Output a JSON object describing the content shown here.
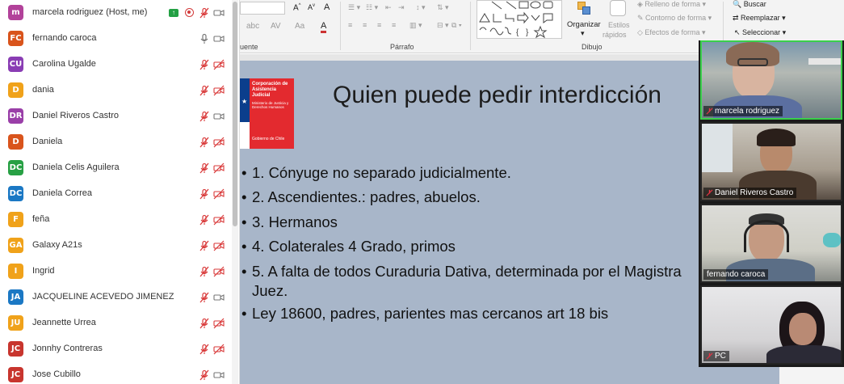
{
  "participants": [
    {
      "initials": "m",
      "name": "marcela rodriguez (Host, me)",
      "color": "#b2429a",
      "mic": "host"
    },
    {
      "initials": "FC",
      "name": "fernando caroca",
      "color": "#d9541c",
      "mic": "on"
    },
    {
      "initials": "CU",
      "name": "Carolina Ugalde",
      "color": "#8a3db4",
      "mic": "muted-video-off"
    },
    {
      "initials": "D",
      "name": "dania",
      "color": "#f0a21a",
      "mic": "muted-video-off"
    },
    {
      "initials": "DR",
      "name": "Daniel Riveros Castro",
      "color": "#9a3fa8",
      "mic": "muted-video-on"
    },
    {
      "initials": "D",
      "name": "Daniela",
      "color": "#d9541c",
      "mic": "muted-video-off"
    },
    {
      "initials": "DC",
      "name": "Daniela Celis Aguilera",
      "color": "#27a044",
      "mic": "muted-video-off"
    },
    {
      "initials": "DC",
      "name": "Daniela Correa",
      "color": "#1b78c4",
      "mic": "muted-video-off"
    },
    {
      "initials": "F",
      "name": "feña",
      "color": "#f0a21a",
      "mic": "muted-video-off"
    },
    {
      "initials": "GA",
      "name": "Galaxy A21s",
      "color": "#f0a21a",
      "mic": "muted-video-off"
    },
    {
      "initials": "I",
      "name": "Ingrid",
      "color": "#f0a21a",
      "mic": "muted-video-off"
    },
    {
      "initials": "JA",
      "name": "JACQUELINE ACEVEDO JIMENEZ",
      "color": "#1b78c4",
      "mic": "muted-video-on"
    },
    {
      "initials": "JU",
      "name": "Jeannette Urrea",
      "color": "#f0a21a",
      "mic": "muted-video-off"
    },
    {
      "initials": "JC",
      "name": "Jonnhy Contreras",
      "color": "#c8352e",
      "mic": "muted-video-off"
    },
    {
      "initials": "JC",
      "name": "Jose Cubillo",
      "color": "#c8352e",
      "mic": "muted-video-on"
    }
  ],
  "ribbon": {
    "group_fuente": "uente",
    "group_parrafo": "Párrafo",
    "group_dibujo": "Dibujo",
    "organizar": "Organizar",
    "estilos": "Estilos",
    "rapidos": "rápidos",
    "relleno": "Relleno de forma",
    "contorno": "Contorno de forma",
    "efectos": "Efectos de forma",
    "buscar": "Buscar",
    "reemplazar": "Reemplazar",
    "seleccionar": "Seleccionar"
  },
  "slide": {
    "logo_lines": "Corporación de Asistencia Judicial",
    "logo_ministry": "Ministerio de Justicia y Derechos Humanos",
    "logo_gob": "Gobierno de Chile",
    "title": "Quien puede pedir interdicción",
    "bullets": [
      "1.  Cónyuge no separado judicialmente.",
      "2. Ascendientes.: padres, abuelos.",
      "3. Hermanos",
      "4. Colaterales 4 Grado, primos",
      "5. A falta de todos Curaduria Dativa, determinada por el Magistra",
      "Ley 18600, padres, parientes mas cercanos art 18 bis"
    ],
    "bullet5_cont": "Juez.",
    "bullet_symbol": "•"
  },
  "videos": [
    {
      "name": "marcela rodriguez",
      "active": true
    },
    {
      "name": "Daniel Riveros Castro",
      "active": false
    },
    {
      "name": "fernando caroca",
      "active": false
    },
    {
      "name": "PC",
      "active": false
    }
  ]
}
